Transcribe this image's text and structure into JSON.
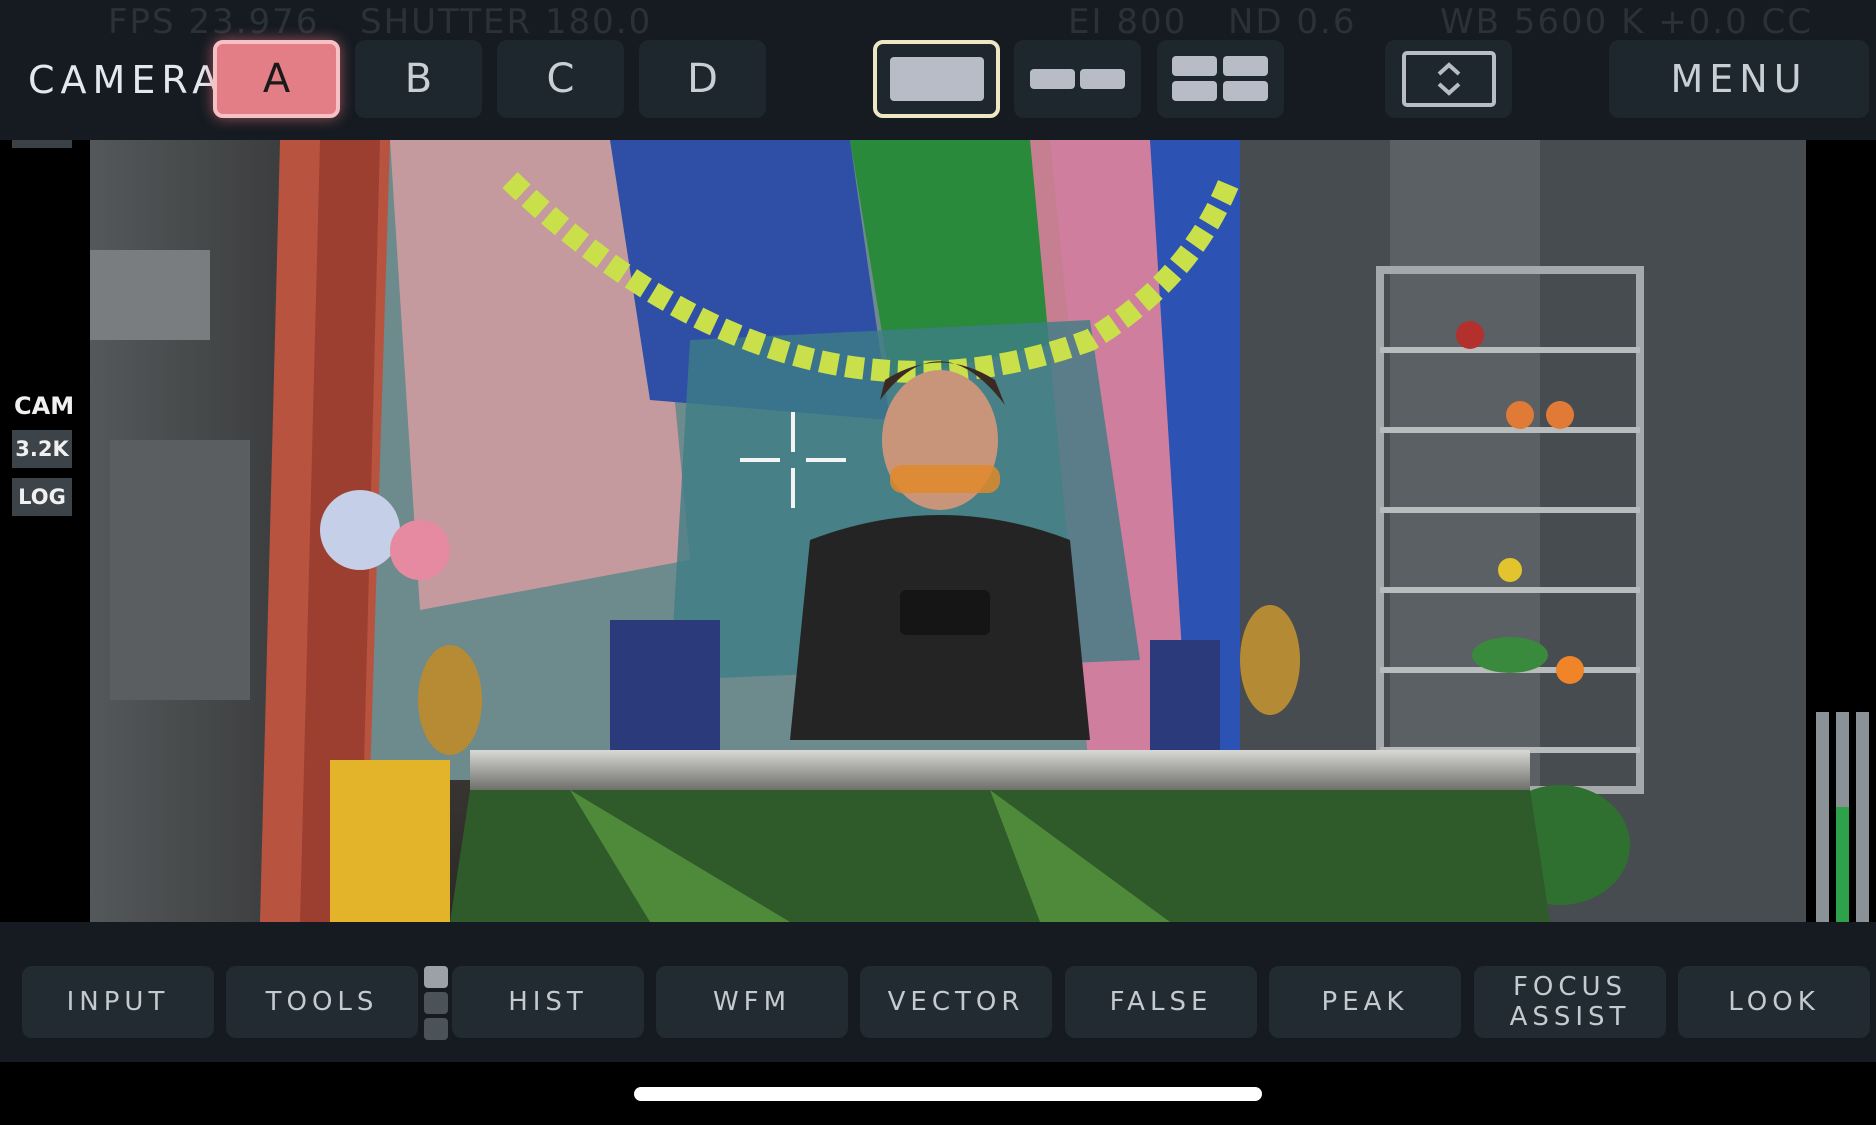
{
  "header": {
    "camera_label": "CAMERA",
    "camera_tabs": [
      "A",
      "B",
      "C",
      "D"
    ],
    "active_camera": "A",
    "layouts": [
      "single-view-icon",
      "dual-view-icon",
      "quad-view-icon"
    ],
    "active_layout": "single-view-icon",
    "expand_icon": "expand-vertical-icon",
    "menu_label": "MENU"
  },
  "status_ghost": {
    "fps": "FPS 23.976",
    "shutter": "SHUTTER 180.0",
    "ei": "EI 800",
    "nd": "ND 0.6",
    "wb": "WB 5600 K +0.0 CC"
  },
  "sidebar": {
    "cam_tag": "CAM",
    "resolution": "3.2K",
    "gamma": "LOG"
  },
  "toolbar": {
    "buttons": [
      "INPUT",
      "TOOLS",
      "HIST",
      "WFM",
      "VECTOR",
      "FALSE",
      "PEAK",
      "FOCUS ASSIST",
      "LOOK"
    ],
    "page_count": 3,
    "active_page": 1
  },
  "audio_meters": {
    "channels": 3,
    "levels": [
      0.0,
      0.55,
      0.0
    ]
  }
}
